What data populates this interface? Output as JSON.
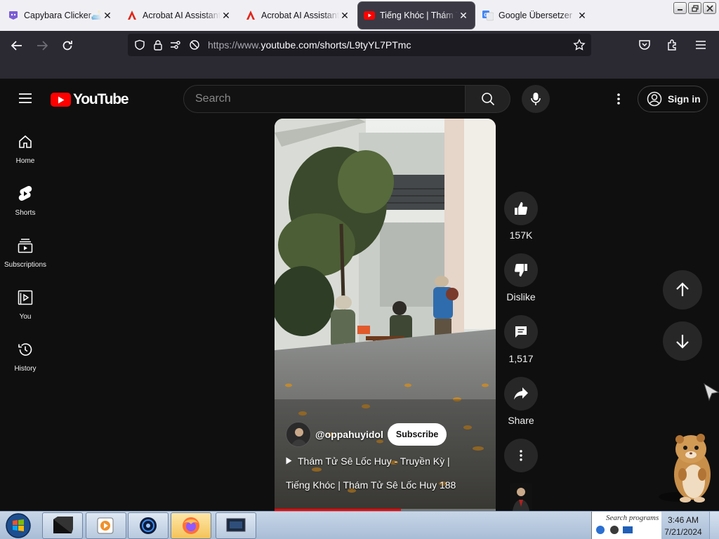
{
  "browser": {
    "tabs": [
      {
        "title": "Capybara Clicker🛋️",
        "icon": "capybara-clicker-icon",
        "close": "✕"
      },
      {
        "title": "Acrobat AI Assistant",
        "icon": "adobe-acrobat-icon",
        "close": "✕"
      },
      {
        "title": "Acrobat AI Assistant",
        "icon": "adobe-acrobat-icon",
        "close": "✕"
      },
      {
        "title": "Tiếng Khóc | Thám Tử",
        "icon": "youtube-icon",
        "close": "✕",
        "active": true
      },
      {
        "title": "Google Übersetzer",
        "icon": "google-translate-icon",
        "close": "✕"
      }
    ],
    "url_prefix": "https://www.",
    "url_host_path": "youtube.com/shorts/L9tyYL7PTmc"
  },
  "youtube": {
    "logo_text": "YouTube",
    "search_placeholder": "Search",
    "signin_label": "Sign in",
    "guide": [
      {
        "label": "Home",
        "icon": "home-icon"
      },
      {
        "label": "Shorts",
        "icon": "shorts-icon"
      },
      {
        "label": "Subscriptions",
        "icon": "subscriptions-icon"
      },
      {
        "label": "You",
        "icon": "you-icon"
      },
      {
        "label": "History",
        "icon": "history-icon"
      }
    ],
    "short": {
      "channel_handle": "@oppahuyidol",
      "subscribe_label": "Subscribe",
      "title_line1": "Thám Tử Sê Lốc Huy - Truyền Kỳ |",
      "title_line2": "Tiếng Khóc | Thám Tử Sê Lốc Huy 188",
      "progress": 0.57
    },
    "actions": {
      "like_count": "157K",
      "dislike_label": "Dislike",
      "comments_count": "1,517",
      "share_label": "Share"
    },
    "colors": {
      "brand_red": "#ff0000",
      "background": "#0f0f0f",
      "button_gray": "#272727"
    }
  },
  "taskbar": {
    "search_placeholder": "Search programs",
    "time": "3:46 AM",
    "date": "7/21/2024"
  }
}
